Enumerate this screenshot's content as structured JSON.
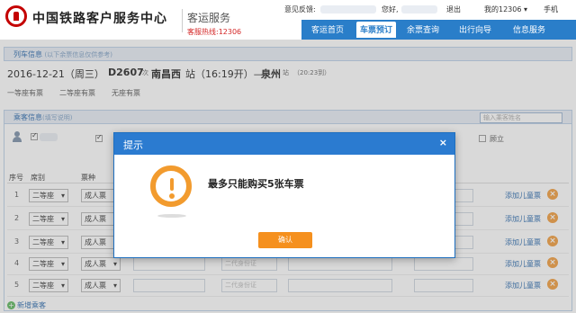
{
  "header": {
    "brand": "中国铁路客户服务中心",
    "sub": "客运服务",
    "hotline": "客服热线:12306",
    "links": {
      "feedback": "意见反馈:",
      "greeting": "您好,",
      "logout": "退出",
      "my12306": "我的12306 ▾",
      "mobile": "手机"
    }
  },
  "nav": {
    "items": [
      "客运首页",
      "车票预订",
      "余票查询",
      "出行向导",
      "信息服务"
    ],
    "active_index": 1
  },
  "train_info": {
    "section_title": "列车信息",
    "section_hint": "(以下余票信息仅供参考)",
    "date": "2016-12-21（周三）",
    "train_no": "D2607",
    "train_suffix": "次",
    "from_station": "南昌西",
    "from_suffix": "站（16:19开）—",
    "to_station": "泉州",
    "to_suffix": "站",
    "arrive": "（20:23到）",
    "seats": [
      "一等座有票",
      "二等座有票",
      "无座有票"
    ]
  },
  "passenger_info": {
    "section_title": "乘客信息",
    "section_hint": "(填写说明)",
    "search_placeholder": "输入乘客姓名",
    "extra_option": "顾立",
    "columns": [
      "序号",
      "席别",
      "票种"
    ],
    "rows": [
      {
        "num": "1",
        "seat": "二等座",
        "ticket": "成人票"
      },
      {
        "num": "2",
        "seat": "二等座",
        "ticket": "成人票"
      },
      {
        "num": "3",
        "seat": "二等座",
        "ticket": "成人票"
      },
      {
        "num": "4",
        "seat": "二等座",
        "ticket": "成人票"
      },
      {
        "num": "5",
        "seat": "二等座",
        "ticket": "成人票"
      }
    ],
    "id_type": "二代身份证",
    "add_child": "添加儿童票",
    "add_passenger": "新增乘客"
  },
  "dialog": {
    "title": "提示",
    "close": "×",
    "message": "最多只能购买5张车票",
    "ok": "确认"
  },
  "colors": {
    "nav_blue": "#2a7ec9",
    "warn_orange": "#f29b2e",
    "ok_orange": "#f5901e",
    "hotline_red": "#d42828"
  }
}
